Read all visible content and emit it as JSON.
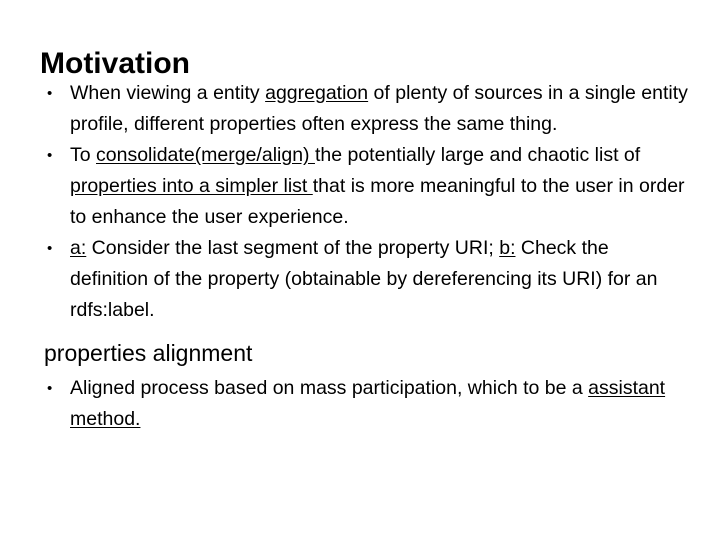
{
  "slide": {
    "title": "Motivation",
    "bullets": [
      {
        "parts": [
          {
            "text": "When viewing a entity ",
            "underline": false
          },
          {
            "text": "aggregation",
            "underline": true
          },
          {
            "text": " of plenty of sources in a single entity profile, different properties often express the same thing.",
            "underline": false
          }
        ]
      },
      {
        "parts": [
          {
            "text": "To ",
            "underline": false
          },
          {
            "text": "consolidate(merge/align) ",
            "underline": true
          },
          {
            "text": "the potentially large and chaotic list of ",
            "underline": false
          },
          {
            "text": "properties into a simpler list ",
            "underline": true
          },
          {
            "text": "that is more meaningful to the user in order to enhance the user experience.",
            "underline": false
          }
        ]
      },
      {
        "parts": [
          {
            "text": "a:",
            "underline": true
          },
          {
            "text": " Consider the last segment of the property URI; ",
            "underline": false
          },
          {
            "text": "b:",
            "underline": true
          },
          {
            "text": " Check the definition of the property (obtainable by dereferencing its URI) for an rdfs:label.",
            "underline": false
          }
        ]
      }
    ],
    "subheading": "properties alignment",
    "sub_bullets": [
      {
        "parts": [
          {
            "text": "Aligned process based on mass participation, which to be a ",
            "underline": false
          },
          {
            "text": "assistant method.",
            "underline": true
          }
        ]
      }
    ]
  },
  "colors": {
    "background": "#ffffff",
    "text": "#000000"
  }
}
